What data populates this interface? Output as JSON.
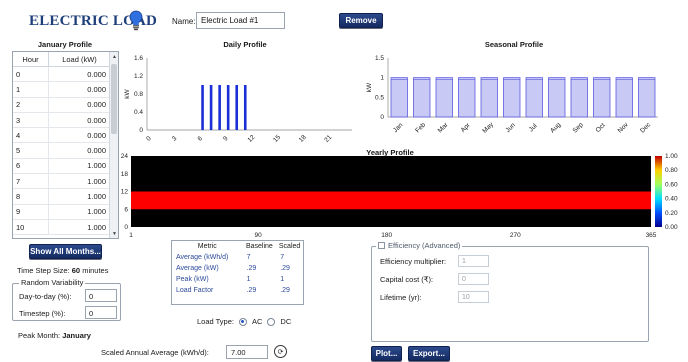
{
  "header": {
    "title": "ELECTRIC LOAD",
    "name_label": "Name:",
    "name_value": "Electric Load #1",
    "remove_label": "Remove"
  },
  "january_profile": {
    "title": "January Profile",
    "columns": [
      "Hour",
      "Load (kW)"
    ],
    "rows": [
      {
        "hour": "0",
        "load": "0.000"
      },
      {
        "hour": "1",
        "load": "0.000"
      },
      {
        "hour": "2",
        "load": "0.000"
      },
      {
        "hour": "3",
        "load": "0.000"
      },
      {
        "hour": "4",
        "load": "0.000"
      },
      {
        "hour": "5",
        "load": "0.000"
      },
      {
        "hour": "6",
        "load": "1.000"
      },
      {
        "hour": "7",
        "load": "1.000"
      },
      {
        "hour": "8",
        "load": "1.000"
      },
      {
        "hour": "9",
        "load": "1.000"
      },
      {
        "hour": "10",
        "load": "1.000"
      }
    ],
    "show_all_label": "Show All Months..."
  },
  "time_step": {
    "label": "Time Step Size:",
    "value": "60",
    "unit": "minutes"
  },
  "random_variability": {
    "legend": "Random Variability",
    "day_to_day_label": "Day-to-day (%):",
    "day_to_day_value": "0",
    "timestep_label": "Timestep (%):",
    "timestep_value": "0"
  },
  "peak_month": {
    "label": "Peak Month:",
    "value": "January"
  },
  "scaled_annual": {
    "label": "Scaled Annual Average (kWh/d):",
    "value": "7.00"
  },
  "metrics": {
    "headers": [
      "Metric",
      "Baseline",
      "Scaled"
    ],
    "rows": [
      {
        "metric": "Average (kWh/d)",
        "baseline": "7",
        "scaled": "7"
      },
      {
        "metric": "Average (kW)",
        "baseline": ".29",
        "scaled": ".29"
      },
      {
        "metric": "Peak (kW)",
        "baseline": "1",
        "scaled": "1"
      },
      {
        "metric": "Load Factor",
        "baseline": ".29",
        "scaled": ".29"
      }
    ]
  },
  "load_type": {
    "label": "Load Type:",
    "options": [
      "AC",
      "DC"
    ],
    "selected": "AC"
  },
  "efficiency": {
    "legend": "Efficiency (Advanced)",
    "multiplier_label": "Efficiency multiplier:",
    "multiplier_value": "1",
    "capital_label": "Capital cost (₹):",
    "capital_value": "0",
    "lifetime_label": "Lifetime (yr):",
    "lifetime_value": "10"
  },
  "buttons": {
    "plot": "Plot...",
    "export": "Export..."
  },
  "colors": {
    "accent": "#1f3f7a",
    "bar_blue": "#1c2fd6",
    "box_fill": "#c9c9f5",
    "box_stroke": "#5a5ae0"
  },
  "chart_data": [
    {
      "type": "bar",
      "title": "Daily Profile",
      "ylabel": "kW",
      "ylim": [
        0,
        1.6
      ],
      "yticks": [
        "0",
        "0.4",
        "0.8",
        "1.2",
        "1.6"
      ],
      "xticks": [
        "0",
        "3",
        "6",
        "9",
        "12",
        "15",
        "18",
        "21"
      ],
      "x": [
        6,
        7,
        8,
        9,
        10,
        11
      ],
      "values": [
        1,
        1,
        1,
        1,
        1,
        1
      ]
    },
    {
      "type": "box",
      "title": "Seasonal Profile",
      "ylabel": "kW",
      "ylim": [
        0,
        1.5
      ],
      "yticks": [
        "0",
        "0.5",
        "1",
        "1.5"
      ],
      "categories": [
        "Jan",
        "Feb",
        "Mar",
        "Apr",
        "May",
        "Jun",
        "Jul",
        "Aug",
        "Sep",
        "Oct",
        "Nov",
        "Dec"
      ],
      "max": [
        1,
        1,
        1,
        1,
        1,
        1,
        1,
        1,
        1,
        1,
        1,
        1
      ],
      "min": [
        0,
        0,
        0,
        0,
        0,
        0,
        0,
        0,
        0,
        0,
        0,
        0
      ]
    },
    {
      "type": "heatmap",
      "title": "Yearly Profile",
      "yticks": [
        "0",
        "6",
        "12",
        "18",
        "24"
      ],
      "xticks": [
        "1",
        "90",
        "180",
        "270",
        "365"
      ],
      "active_hours": [
        6,
        12
      ],
      "colorbar": [
        "0.00",
        "0.20",
        "0.40",
        "0.60",
        "0.80",
        "1.00"
      ]
    }
  ]
}
